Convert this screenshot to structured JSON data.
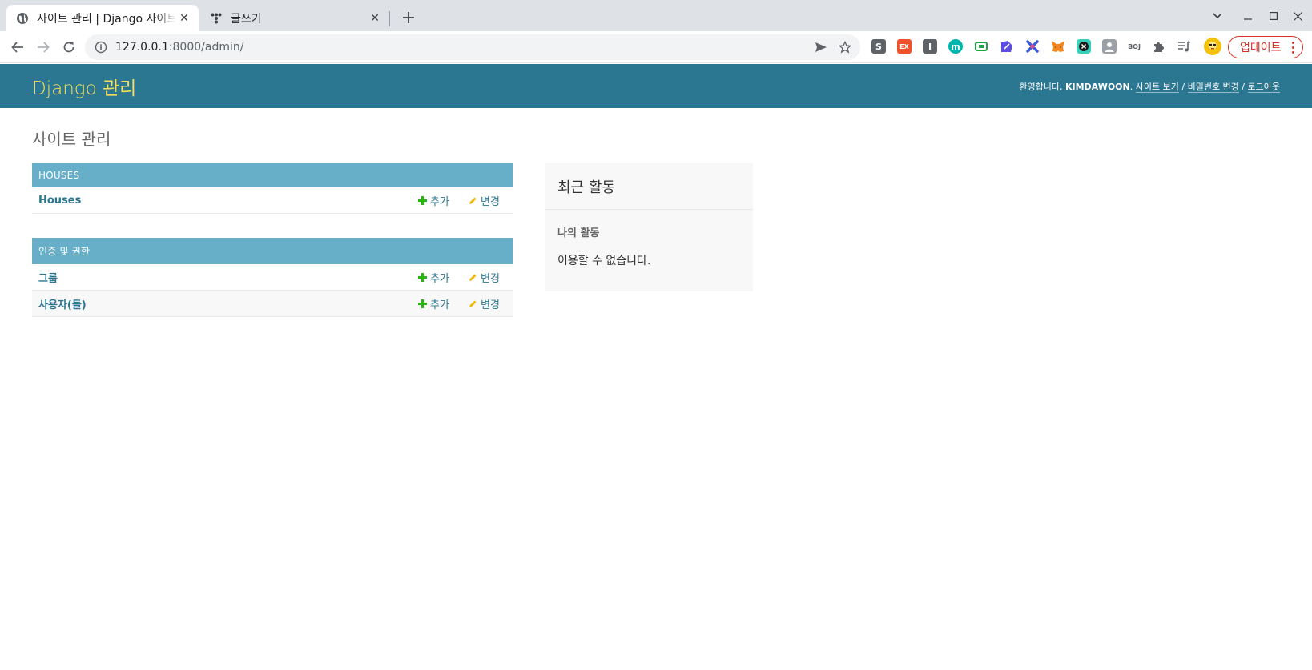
{
  "browser": {
    "tabs": [
      {
        "title": "사이트 관리 | Django 사이트 관리",
        "active": true
      },
      {
        "title": "글쓰기",
        "active": false
      }
    ],
    "url_host": "127.0.0.1",
    "url_path": ":8000/admin/",
    "update_label": "업데이트",
    "extensions": [
      {
        "name": "s-extension-icon",
        "glyph": "S",
        "color": "#5f6368"
      },
      {
        "name": "ex-extension-icon",
        "glyph": "EX",
        "color": "#f0502a"
      },
      {
        "name": "i-extension-icon",
        "glyph": "I",
        "color": "#5f6368"
      },
      {
        "name": "m-extension-icon",
        "glyph": "m",
        "color": "#00b5ad"
      },
      {
        "name": "green-extension-icon",
        "glyph": "▣",
        "color": "#1ea446"
      },
      {
        "name": "pen-extension-icon",
        "glyph": "✎",
        "color": "#5b4de0"
      },
      {
        "name": "cross-extension-icon",
        "glyph": "✕",
        "color": "#3b5bdb"
      },
      {
        "name": "metamask-fox-icon",
        "glyph": "🦊",
        "color": "#f6851b"
      },
      {
        "name": "x-circle-extension-icon",
        "glyph": "✖",
        "color": "#1a1a1a"
      },
      {
        "name": "profile-extension-icon",
        "glyph": "◻",
        "color": "#9aa0a6"
      },
      {
        "name": "boj-extension-icon",
        "glyph": "BOJ",
        "color": "#5f6368"
      }
    ]
  },
  "header": {
    "branding": "Django 관리",
    "welcome": "환영합니다,",
    "username": "KIMDAWOON",
    "view_site": "사이트 보기",
    "change_password": "비밀번호 변경",
    "logout": "로그아웃",
    "separator": "/"
  },
  "content": {
    "title": "사이트 관리",
    "modules": [
      {
        "caption": "HOUSES",
        "rows": [
          {
            "name": "Houses",
            "add": "추가",
            "change": "변경"
          }
        ]
      },
      {
        "caption": "인증 및 권한",
        "rows": [
          {
            "name": "그룹",
            "add": "추가",
            "change": "변경"
          },
          {
            "name": "사용자(들)",
            "add": "추가",
            "change": "변경"
          }
        ]
      }
    ],
    "recent": {
      "title": "최근 활동",
      "subtitle": "나의 활동",
      "empty": "이용할 수 없습니다."
    }
  },
  "colors": {
    "header_bg": "#2b7791",
    "branding": "#f5dd5d",
    "module_caption": "#67aec8",
    "link": "#2b7791",
    "add_icon": "#25b70c",
    "change_icon": "#efb80b"
  }
}
